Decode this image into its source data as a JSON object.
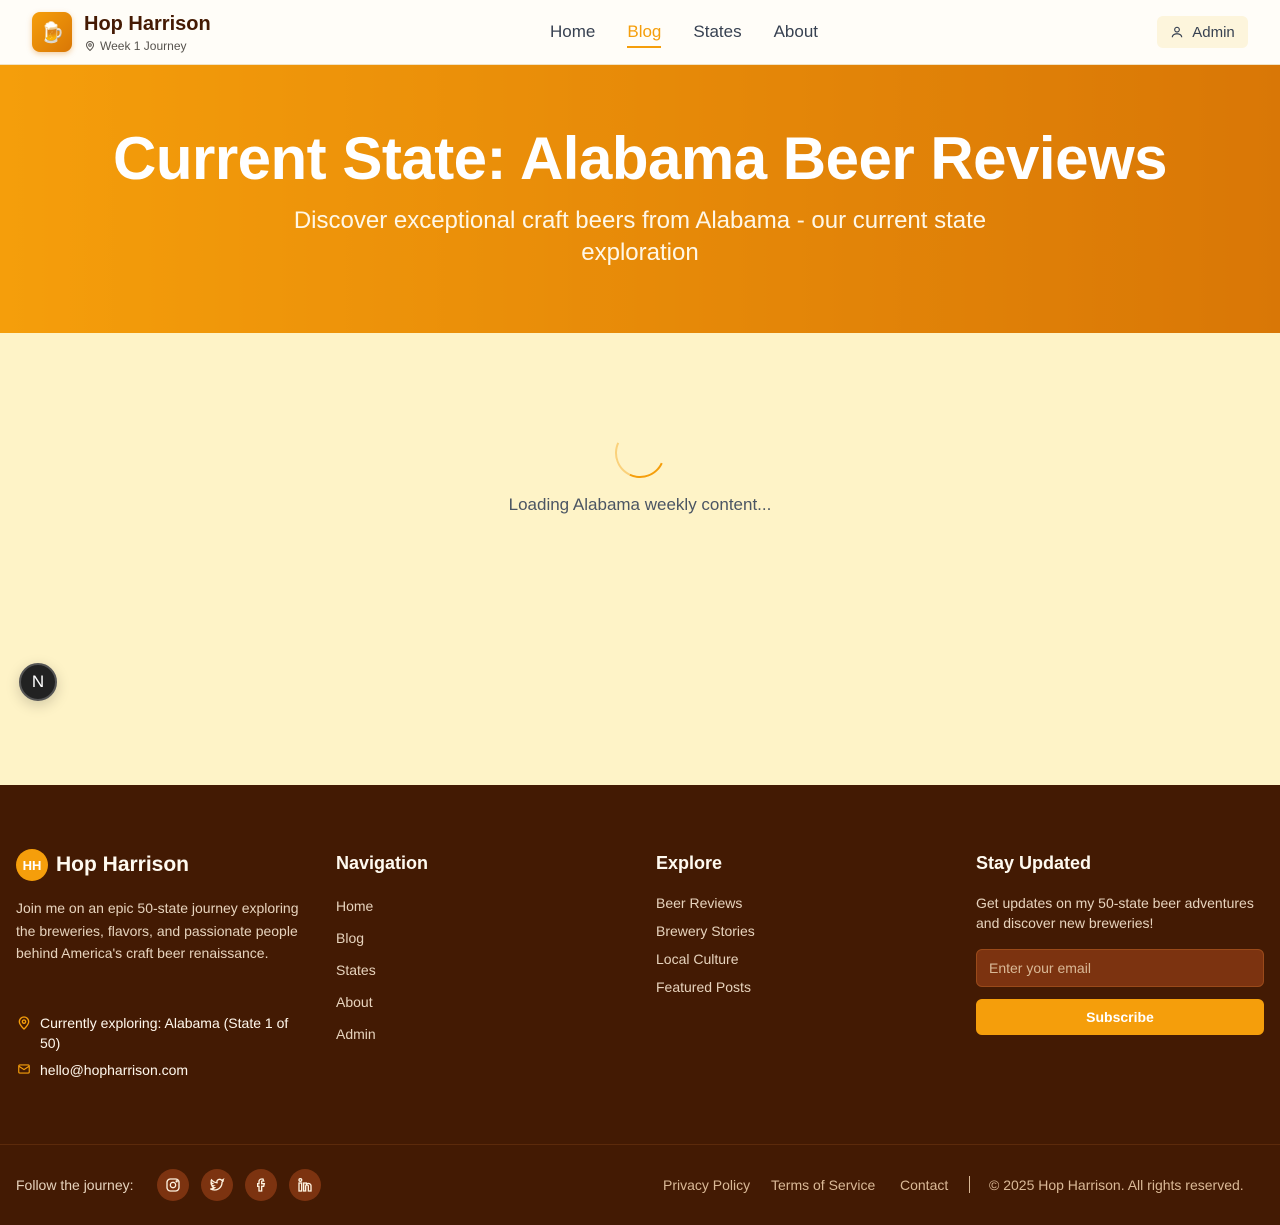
{
  "header": {
    "brand_title": "Hop Harrison",
    "brand_subtitle": "Week 1 Journey",
    "logo_icon": "beer-mug-icon",
    "nav": [
      {
        "label": "Home",
        "active": false
      },
      {
        "label": "Blog",
        "active": true
      },
      {
        "label": "States",
        "active": false
      },
      {
        "label": "About",
        "active": false
      }
    ],
    "admin_label": "Admin"
  },
  "hero": {
    "title": "Current State: Alabama Beer Reviews",
    "subtitle": "Discover exceptional craft beers from Alabama - our current state exploration"
  },
  "main": {
    "loading_text": "Loading Alabama weekly content..."
  },
  "dev_badge": {
    "letter": "N"
  },
  "footer": {
    "logo_initials": "HH",
    "brand": "Hop Harrison",
    "description": "Join me on an epic 50-state journey exploring the breweries, flavors, and passionate people behind America's craft beer renaissance.",
    "current_location": "Currently exploring: Alabama (State 1 of 50)",
    "email": "hello@hopharrison.com",
    "navigation": {
      "heading": "Navigation",
      "links": [
        "Home",
        "Blog",
        "States",
        "About",
        "Admin"
      ]
    },
    "explore": {
      "heading": "Explore",
      "links": [
        "Beer Reviews",
        "Brewery Stories",
        "Local Culture",
        "Featured Posts"
      ]
    },
    "newsletter": {
      "heading": "Stay Updated",
      "text": "Get updates on my 50-state beer adventures and discover new breweries!",
      "placeholder": "Enter your email",
      "button": "Subscribe"
    },
    "follow_label": "Follow the journey:",
    "social": [
      "instagram-icon",
      "twitter-icon",
      "facebook-icon",
      "linkedin-icon"
    ],
    "legal": {
      "privacy": "Privacy Policy",
      "terms": "Terms of Service",
      "contact": "Contact",
      "copyright": "© 2025 Hop Harrison. All rights reserved."
    }
  },
  "colors": {
    "accent": "#f59e0b",
    "accent_dark": "#d97706",
    "page_bg": "#fef3c7",
    "footer_bg": "#431a03"
  }
}
